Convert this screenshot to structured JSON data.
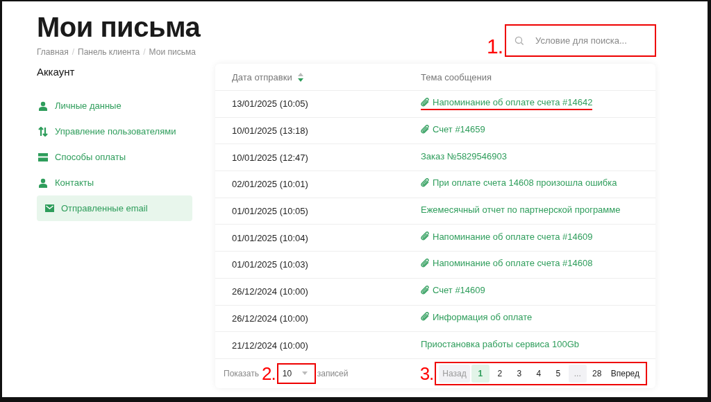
{
  "page": {
    "title": "Мои письма"
  },
  "breadcrumbs": [
    "Главная",
    "Панель клиента",
    "Мои письма"
  ],
  "breadcrumb_separator": "/",
  "search": {
    "placeholder": "Условие для поиска...",
    "annotation": "1."
  },
  "sidebar": {
    "heading": "Аккаунт",
    "items": [
      {
        "label": "Личные данные",
        "selected": false
      },
      {
        "label": "Управление пользователями",
        "selected": false
      },
      {
        "label": "Способы оплаты",
        "selected": false
      },
      {
        "label": "Контакты",
        "selected": false
      },
      {
        "label": "Отправленные email",
        "selected": true
      }
    ]
  },
  "table": {
    "columns": [
      {
        "label": "Дата отправки",
        "sorted_descending": true
      },
      {
        "label": "Тема сообщения"
      }
    ],
    "rows": [
      {
        "date": "13/01/2025 (10:05)",
        "subject": "Напоминание об оплате счета #14642",
        "attachment": true,
        "underlined": true
      },
      {
        "date": "10/01/2025 (13:18)",
        "subject": "Счет #14659",
        "attachment": true,
        "underlined": false
      },
      {
        "date": "10/01/2025 (12:47)",
        "subject": "Заказ №5829546903",
        "attachment": false,
        "underlined": false
      },
      {
        "date": "02/01/2025 (10:01)",
        "subject": "При оплате счета 14608 произошла ошибка",
        "attachment": true,
        "underlined": false
      },
      {
        "date": "01/01/2025 (10:05)",
        "subject": "Ежемесячный отчет по партнерской программе",
        "attachment": false,
        "underlined": false
      },
      {
        "date": "01/01/2025 (10:04)",
        "subject": "Напоминание об оплате счета #14609",
        "attachment": true,
        "underlined": false
      },
      {
        "date": "01/01/2025 (10:03)",
        "subject": "Напоминание об оплате счета #14608",
        "attachment": true,
        "underlined": false
      },
      {
        "date": "26/12/2024 (10:00)",
        "subject": "Счет #14609",
        "attachment": true,
        "underlined": false
      },
      {
        "date": "26/12/2024 (10:00)",
        "subject": "Информация об оплате",
        "attachment": true,
        "underlined": false
      },
      {
        "date": "21/12/2024 (10:00)",
        "subject": "Приостановка работы сервиса 100Gb",
        "attachment": false,
        "underlined": false
      }
    ]
  },
  "footer": {
    "show_label": "Показать",
    "per_page": "10",
    "annotation_per_page": "2.",
    "records_label": "записей"
  },
  "pagination": {
    "annotation": "3.",
    "items": [
      {
        "label": "Назад",
        "selected": false,
        "disabled": true
      },
      {
        "label": "1",
        "selected": true,
        "disabled": false
      },
      {
        "label": "2",
        "selected": false,
        "disabled": false
      },
      {
        "label": "3",
        "selected": false,
        "disabled": false
      },
      {
        "label": "4",
        "selected": false,
        "disabled": false
      },
      {
        "label": "5",
        "selected": false,
        "disabled": false
      },
      {
        "label": "...",
        "selected": false,
        "disabled": true
      },
      {
        "label": "28",
        "selected": false,
        "disabled": false
      },
      {
        "label": "Вперед",
        "selected": false,
        "disabled": false
      }
    ]
  }
}
